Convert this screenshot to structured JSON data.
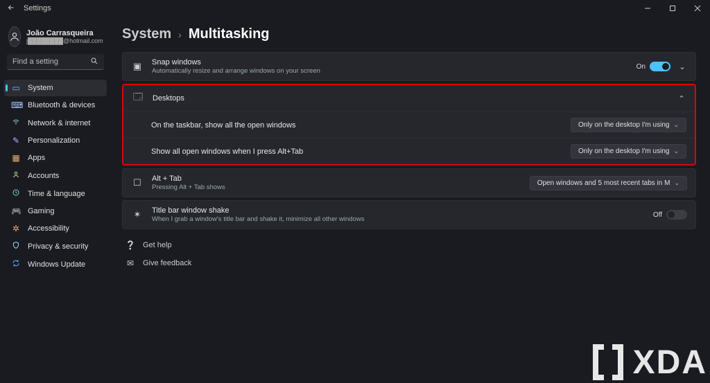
{
  "window": {
    "app_title": "Settings"
  },
  "user": {
    "name": "João Carrasqueira",
    "email": "j████████@hotmail.com"
  },
  "search": {
    "placeholder": "Find a setting"
  },
  "nav": {
    "system": "System",
    "bluetooth": "Bluetooth & devices",
    "network": "Network & internet",
    "personalization": "Personalization",
    "apps": "Apps",
    "accounts": "Accounts",
    "time": "Time & language",
    "gaming": "Gaming",
    "accessibility": "Accessibility",
    "privacy": "Privacy & security",
    "update": "Windows Update"
  },
  "breadcrumb": {
    "parent": "System",
    "current": "Multitasking"
  },
  "snap": {
    "title": "Snap windows",
    "desc": "Automatically resize and arrange windows on your screen",
    "status": "On"
  },
  "desktops": {
    "title": "Desktops",
    "row1_label": "On the taskbar, show all the open windows",
    "row1_value": "Only on the desktop I'm using",
    "row2_label": "Show all open windows when I press Alt+Tab",
    "row2_value": "Only on the desktop I'm using"
  },
  "alttab": {
    "title": "Alt + Tab",
    "desc": "Pressing Alt + Tab shows",
    "value": "Open windows and 5 most recent tabs in M"
  },
  "shake": {
    "title": "Title bar window shake",
    "desc": "When I grab a window's title bar and shake it, minimize all other windows",
    "status": "Off"
  },
  "links": {
    "help": "Get help",
    "feedback": "Give feedback"
  },
  "watermark": {
    "text": "XDA"
  }
}
